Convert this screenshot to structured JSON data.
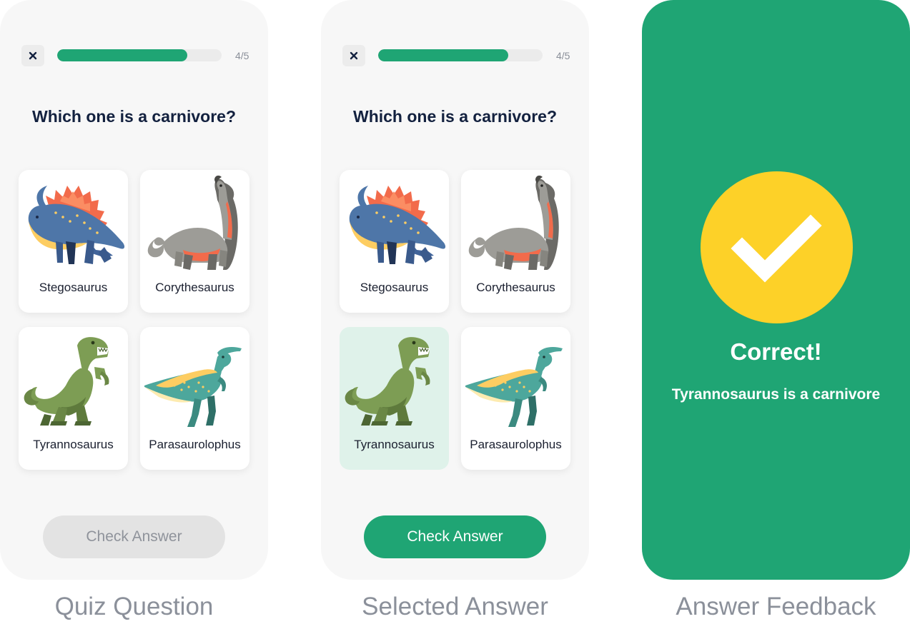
{
  "colors": {
    "accent": "#1fa574",
    "badge": "#fdd128",
    "selected_card": "#dff2ea"
  },
  "quiz": {
    "close_icon": "close-icon",
    "progress": {
      "text": "4/5",
      "fraction": 0.79
    },
    "question": "Which one is a carnivore?",
    "options": [
      {
        "label": "Stegosaurus",
        "icon": "stegosaurus-illustration"
      },
      {
        "label": "Corythesaurus",
        "icon": "corythosaurus-illustration"
      },
      {
        "label": "Tyrannosaurus",
        "icon": "tyrannosaurus-illustration"
      },
      {
        "label": "Parasaurolophus",
        "icon": "parasaurolophus-illustration"
      }
    ],
    "check_button": "Check Answer"
  },
  "screens": [
    {
      "caption": "Quiz Question",
      "selected": null,
      "button_state": "disabled"
    },
    {
      "caption": "Selected Answer",
      "selected": "Tyrannosaurus",
      "button_state": "enabled"
    },
    {
      "caption": "Answer Feedback"
    }
  ],
  "feedback": {
    "icon": "checkmark-icon",
    "title": "Correct!",
    "message": "Tyrannosaurus is a carnivore"
  }
}
